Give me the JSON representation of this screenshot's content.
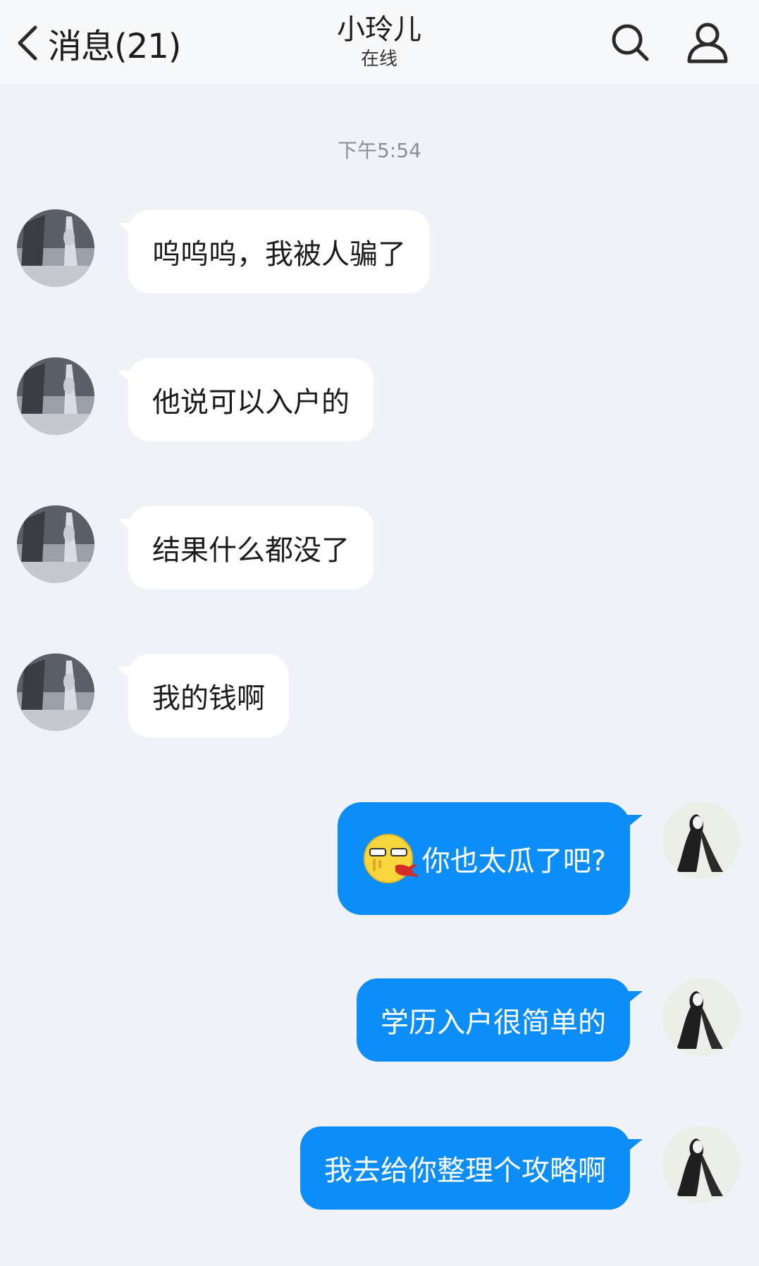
{
  "header": {
    "back_label": "消息(21)",
    "contact_name": "小玲儿",
    "contact_status": "在线",
    "search_icon": "search-icon",
    "profile_icon": "profile-icon"
  },
  "chat": {
    "timestamp": "下午5:54",
    "messages": [
      {
        "side": "incoming",
        "text": "呜呜呜，我被人骗了"
      },
      {
        "side": "incoming",
        "text": "他说可以入户的"
      },
      {
        "side": "incoming",
        "text": "结果什么都没了"
      },
      {
        "side": "incoming",
        "text": "我的钱啊"
      },
      {
        "side": "outgoing",
        "emoji": "nosebleed-emoji",
        "text": "你也太瓜了吧?"
      },
      {
        "side": "outgoing",
        "text": "学历入户很简单的"
      },
      {
        "side": "outgoing",
        "text": "我去给你整理个攻略啊"
      }
    ]
  },
  "colors": {
    "background": "#eff2f6",
    "header": "#f7f8fa",
    "incoming_bubble": "#ffffff",
    "outgoing_bubble": "#0d8df7"
  }
}
